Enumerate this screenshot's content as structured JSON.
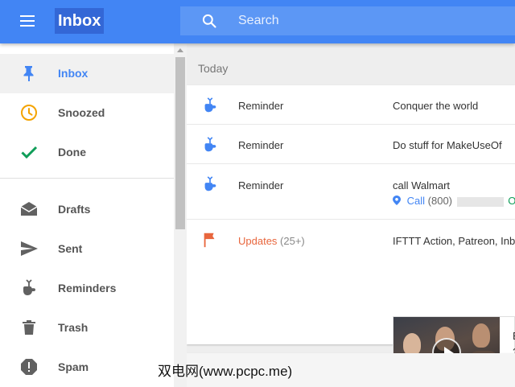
{
  "header": {
    "title": "Inbox",
    "search_placeholder": "Search"
  },
  "colors": {
    "brand_blue": "#4285f4",
    "snoozed_orange": "#f4a300",
    "done_green": "#0f9d58",
    "updates_orange": "#e8663d"
  },
  "sidebar": {
    "items": [
      {
        "label": "Inbox",
        "icon": "pin-icon",
        "active": true
      },
      {
        "label": "Snoozed",
        "icon": "clock-icon"
      },
      {
        "label": "Done",
        "icon": "checkmark-icon"
      },
      {
        "label": "Drafts",
        "icon": "drafts-envelope-icon"
      },
      {
        "label": "Sent",
        "icon": "send-icon"
      },
      {
        "label": "Reminders",
        "icon": "reminder-hand-icon"
      },
      {
        "label": "Trash",
        "icon": "trash-icon"
      },
      {
        "label": "Spam",
        "icon": "spam-icon"
      }
    ]
  },
  "main": {
    "section_label": "Today",
    "rows": [
      {
        "sender": "Reminder",
        "subject": "Conquer the world",
        "icon": "reminder-hand-icon"
      },
      {
        "sender": "Reminder",
        "subject": "Do stuff for MakeUseOf",
        "icon": "reminder-hand-icon"
      },
      {
        "sender": "Reminder",
        "subject": "call Walmart",
        "icon": "reminder-hand-icon",
        "call_label": "Call",
        "phone_prefix": "(800)",
        "open_label": "Op"
      },
      {
        "sender": "Updates",
        "count": "(25+)",
        "subject": "IFTTT Action, Patreon, Inb",
        "icon": "flag-icon",
        "preview_lines": [
          "E",
          "2"
        ]
      }
    ]
  },
  "watermark": "双电网(www.pcpc.me)"
}
